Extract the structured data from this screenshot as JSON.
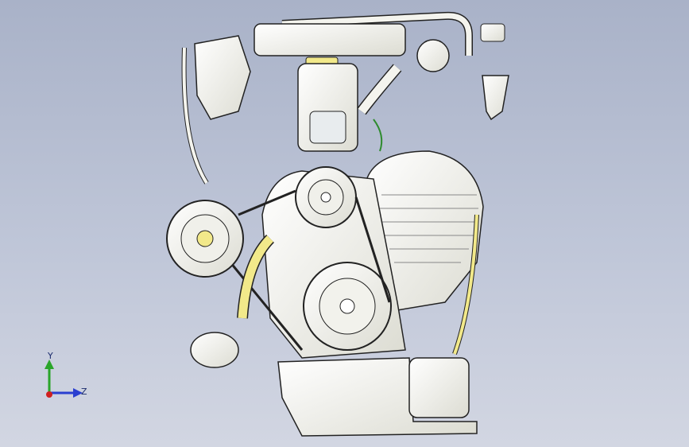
{
  "viewport": {
    "background_top": "#a9b2c8",
    "background_bottom": "#d2d6e2",
    "model": "engine-assembly"
  },
  "colors": {
    "part_fill": "#f4f4ee",
    "part_stroke": "#1e1e1e",
    "accent_yellow": "#f2e98a",
    "accent_green": "#2e8b2e"
  },
  "triad": {
    "y_label": "Y",
    "z_label": "Z",
    "y_color": "#2aa52a",
    "z_color": "#2a3fd0",
    "x_color": "#d02020"
  }
}
